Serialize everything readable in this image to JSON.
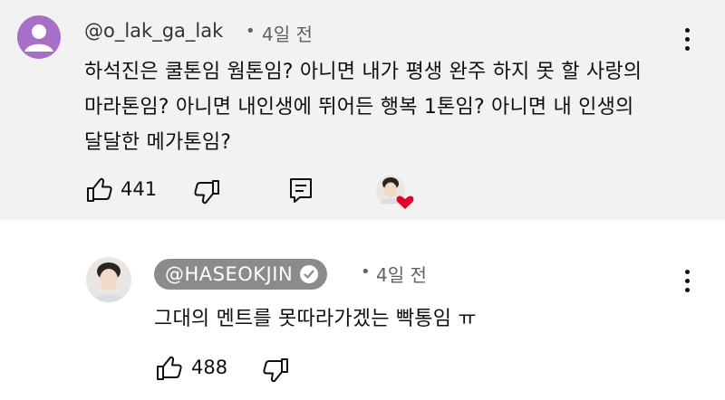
{
  "comment": {
    "author": "@o_lak_ga_lak",
    "separator": "•",
    "time": "4일 전",
    "lines": [
      "하석진은 쿨톤임 웜톤임? 아니면 내가 평생 완주 하지 못 할 사랑의",
      "마라톤임? 아니면 내인생에 뛰어든 행복 1톤임? 아니면 내 인생의",
      "달달한 메가톤임?"
    ],
    "like_count": "441",
    "icons": {
      "like": "thumbs-up-icon",
      "dislike": "thumbs-down-icon",
      "reply": "reply-icon",
      "menu": "more-vert-icon",
      "heart": "creator-heart-icon"
    }
  },
  "reply": {
    "author": "@HASEOKJIN",
    "separator": "•",
    "time": "4일 전",
    "text": "그대의 멘트를 못따라가겠는 빡통임 ㅠ",
    "like_count": "488",
    "icons": {
      "verified": "verified-check-icon",
      "like": "thumbs-up-icon",
      "dislike": "thumbs-down-icon",
      "menu": "more-vert-icon"
    }
  },
  "colors": {
    "comment_bg": "#f2f2f2",
    "avatar_purple": "#a66fc8",
    "badge_gray": "#8b8b8b",
    "heart_red": "#e4002b"
  }
}
